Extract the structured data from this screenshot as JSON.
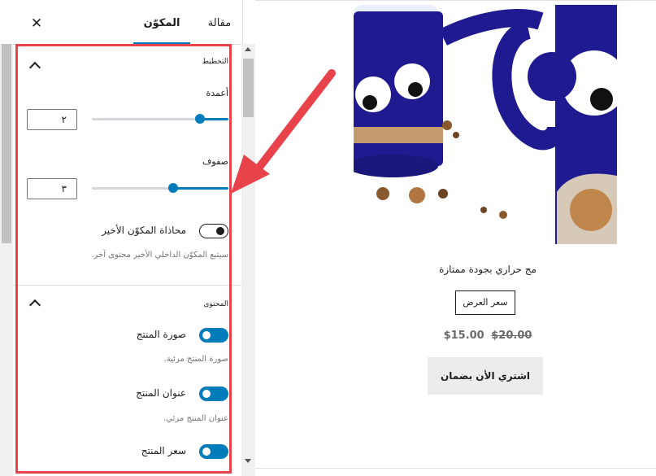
{
  "sidebar": {
    "tabs": [
      {
        "label": "المكوّن",
        "active": true
      },
      {
        "label": "مقالة",
        "active": false
      }
    ],
    "close_icon": "close-icon",
    "layout_panel": {
      "title": "التخطيط",
      "columns_label": "أعمدة",
      "columns_value": "٢",
      "columns_level": 0.2,
      "rows_label": "صفوف",
      "rows_value": "٣",
      "rows_level": 0.4,
      "align_last_label": "محاذاة المكوّن الأخير",
      "align_last_on": false,
      "align_last_help": "سيتبع المكوّن الداخلي الأخير محتوى آخر."
    },
    "content_panel": {
      "title": "المحتوى",
      "image_label": "صورة المنتج",
      "image_help": "صورة المنتج مرئية.",
      "title_label": "عنوان المنتج",
      "title_help": "عنوان المنتج مرئي.",
      "price_label": "سعر المنتج"
    }
  },
  "preview": {
    "product_title": "مج حراري بجودة ممتازة",
    "sale_badge": "سعر العرض",
    "price_current": "$15.00",
    "price_old": "$20.00",
    "buy_button": "اشتري الأن بضمان"
  },
  "colors": {
    "accent": "#007cba",
    "highlight": "#e8434b",
    "mug": "#1f1a8f"
  }
}
